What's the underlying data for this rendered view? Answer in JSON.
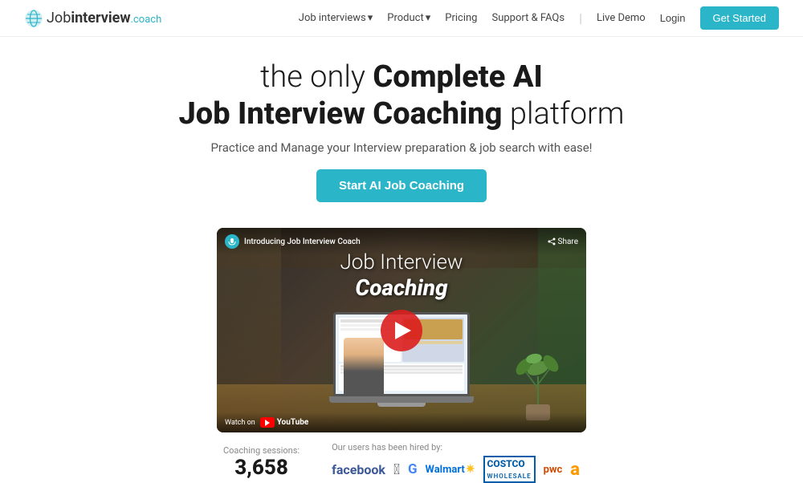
{
  "nav": {
    "logo": {
      "job": "Job",
      "interview": "interview",
      "coach": ".coach"
    },
    "links": [
      {
        "label": "Job interviews",
        "has_dropdown": true
      },
      {
        "label": "Product",
        "has_dropdown": true
      },
      {
        "label": "Pricing",
        "has_dropdown": false
      },
      {
        "label": "Support & FAQs",
        "has_dropdown": false
      },
      {
        "label": "Live Demo",
        "has_dropdown": false
      },
      {
        "label": "Login",
        "has_dropdown": false
      }
    ],
    "cta": "Get Started"
  },
  "hero": {
    "heading_light1": "the only",
    "heading_bold1": "Complete AI",
    "heading_bold2": "Job Interview Coaching",
    "heading_light2": "platform",
    "subtext": "Practice and Manage your Interview preparation & job search with ease!",
    "cta_button": "Start AI Job Coaching"
  },
  "video": {
    "topbar_label": "Introducing Job Interview Coach",
    "share_label": "Share",
    "overlay_title1": "Job Interview",
    "overlay_title2": "Coaching",
    "watch_on": "Watch on",
    "youtube_label": "YouTube"
  },
  "stats": {
    "sessions_label": "Coaching sessions:",
    "sessions_count": "3,658",
    "hired_label": "Our users has been hired by:",
    "companies": [
      "facebook",
      "🍎",
      "G",
      "Walmart ✷",
      "COSTCO WHOLESALE",
      "pwc",
      "a"
    ]
  }
}
